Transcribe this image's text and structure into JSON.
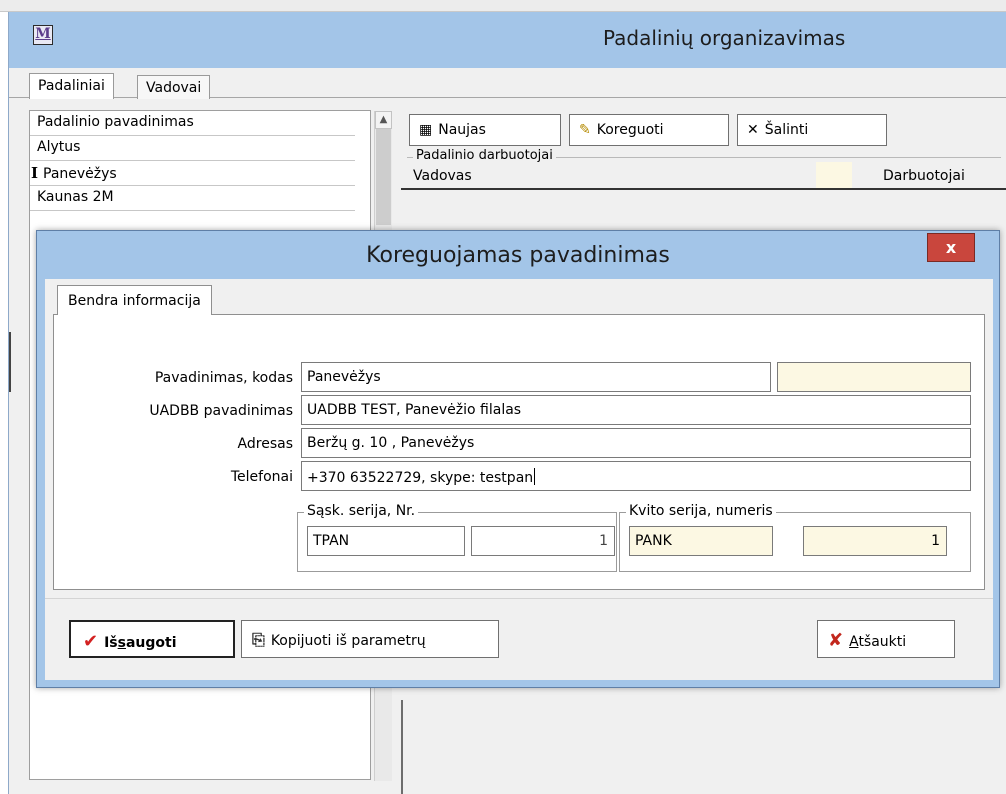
{
  "main_window": {
    "title": "Padalinių organizavimas",
    "app_icon_letter": "M",
    "tabs": [
      "Padaliniai",
      "Vadovai"
    ]
  },
  "list": {
    "header": "Padalinio pavadinimas",
    "rows": [
      "Alytus",
      "Panevėžys",
      "Kaunas 2M"
    ],
    "row_marker": "I"
  },
  "toolbar": {
    "naujas": "Naujas",
    "koreguoti": "Koreguoti",
    "salinti": "Šalinti"
  },
  "employees": {
    "group_title": "Padalinio darbuotojai",
    "col_vadovas": "Vadovas",
    "col_darbuotojai": "Darbuotojai"
  },
  "dialog": {
    "title": "Koreguojamas pavadinimas",
    "close_glyph": "x",
    "tab": "Bendra informacija",
    "fields": {
      "pavadinimas_label": "Pavadinimas, kodas",
      "pavadinimas_value": "Panevėžys",
      "kodas_value": "",
      "uadbb_label": "UADBB pavadinimas",
      "uadbb_value": "UADBB TEST, Panevėžio filalas",
      "adresas_label": "Adresas",
      "adresas_value": "Beržų g. 10 , Panevėžys",
      "telefonai_label": "Telefonai",
      "telefonai_value": "+370 63522729, skype: testpan"
    },
    "sask": {
      "title": "Sąsk. serija, Nr.",
      "serija": "TPAN",
      "nr": "1"
    },
    "kvito": {
      "title": "Kvito serija, numeris",
      "serija": "PANK",
      "nr": "1"
    },
    "buttons": {
      "issaugoti_pre": "Iš",
      "issaugoti_u": "s",
      "issaugoti_post": "augoti",
      "kopijuoti": "Kopijuoti iš parametrų",
      "atsaukti_u": "A",
      "atsaukti_post": "tšaukti"
    }
  },
  "colors": {
    "title_bar": "#a3c5e8",
    "readonly_field": "#fcf8e3",
    "close_button": "#c9463d"
  }
}
